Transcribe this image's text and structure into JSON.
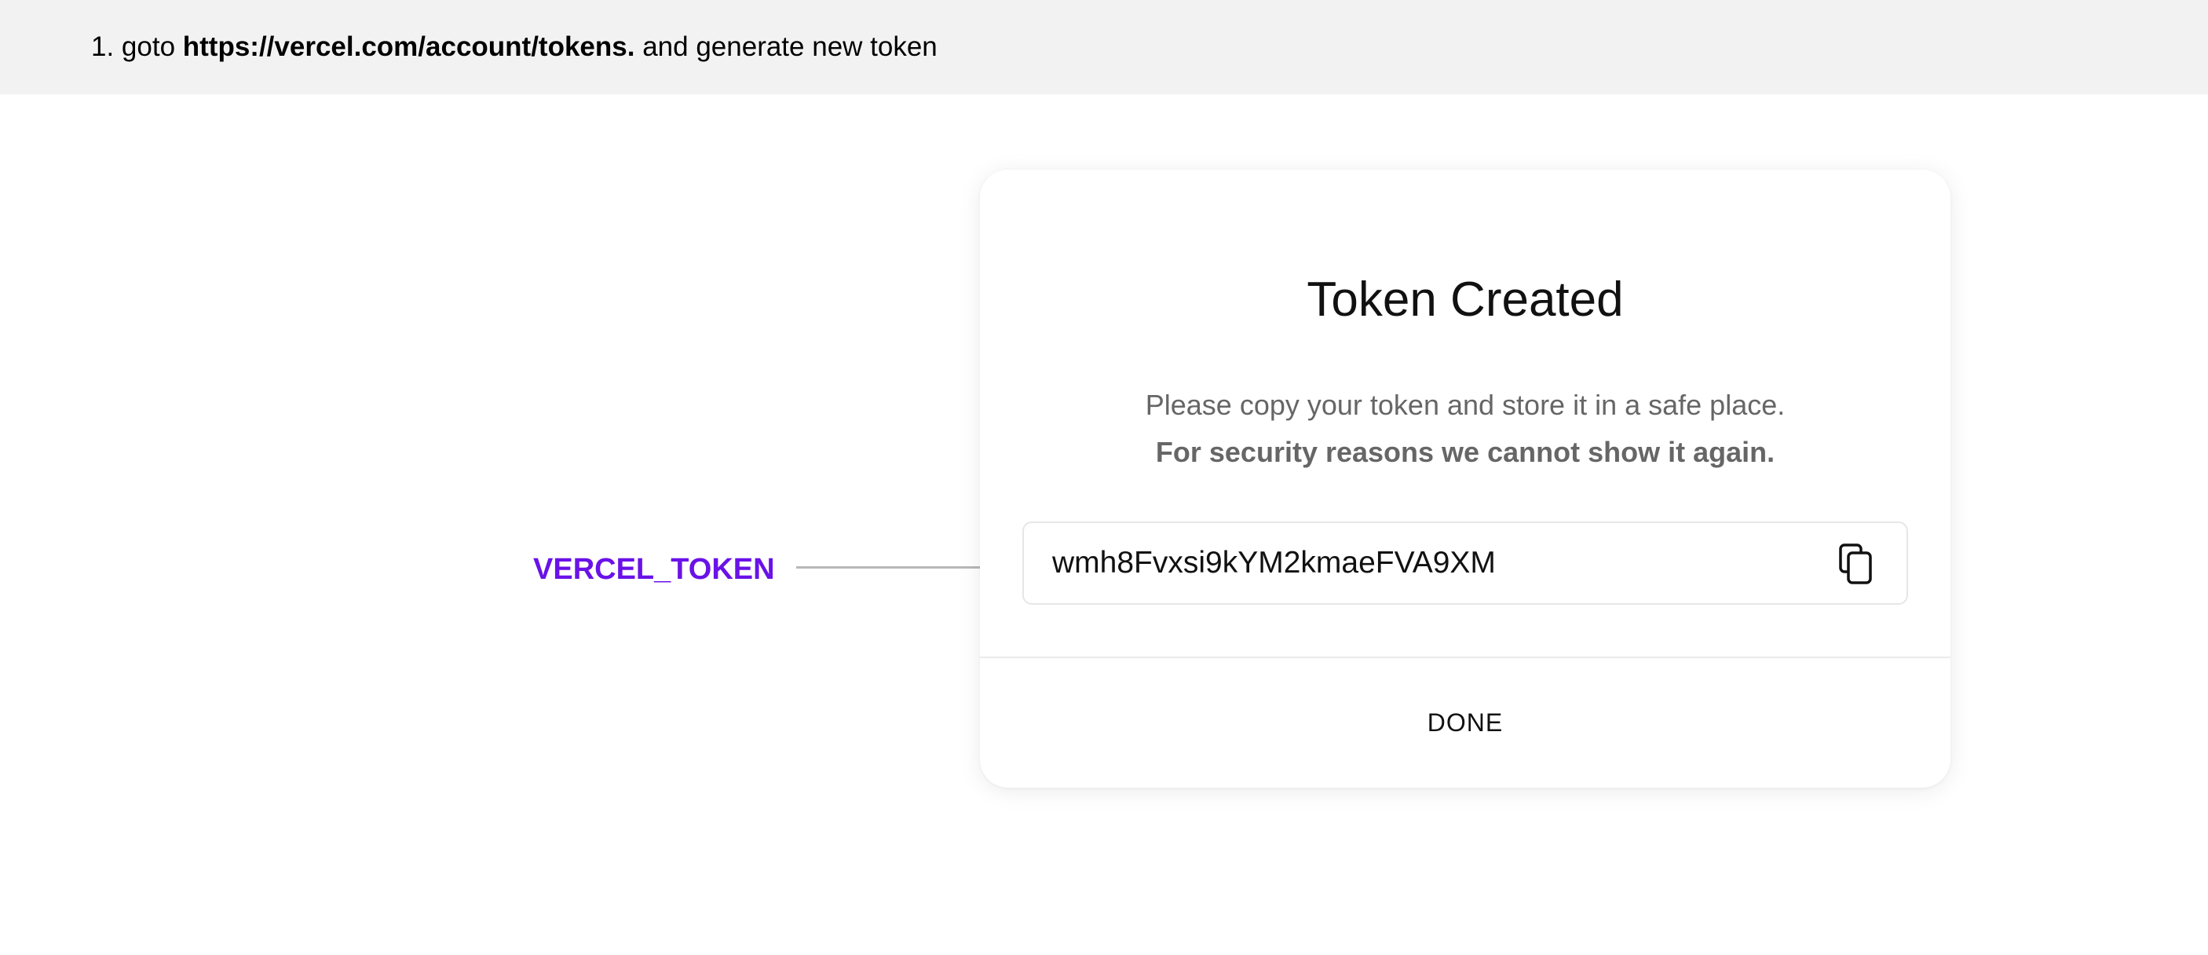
{
  "instruction": {
    "prefix": "1. goto ",
    "url": "https://vercel.com/account/tokens.",
    "suffix": " and generate new token"
  },
  "annotation": {
    "label": "VERCEL_TOKEN",
    "color": "#6a12e8"
  },
  "modal": {
    "title": "Token Created",
    "description": "Please copy your token and store it in a safe place.",
    "warning": "For security reasons we cannot show it again.",
    "token_value": "wmh8Fvxsi9kYM2kmaeFVA9XM",
    "copy_icon": "copy-icon",
    "done_label": "DONE"
  }
}
